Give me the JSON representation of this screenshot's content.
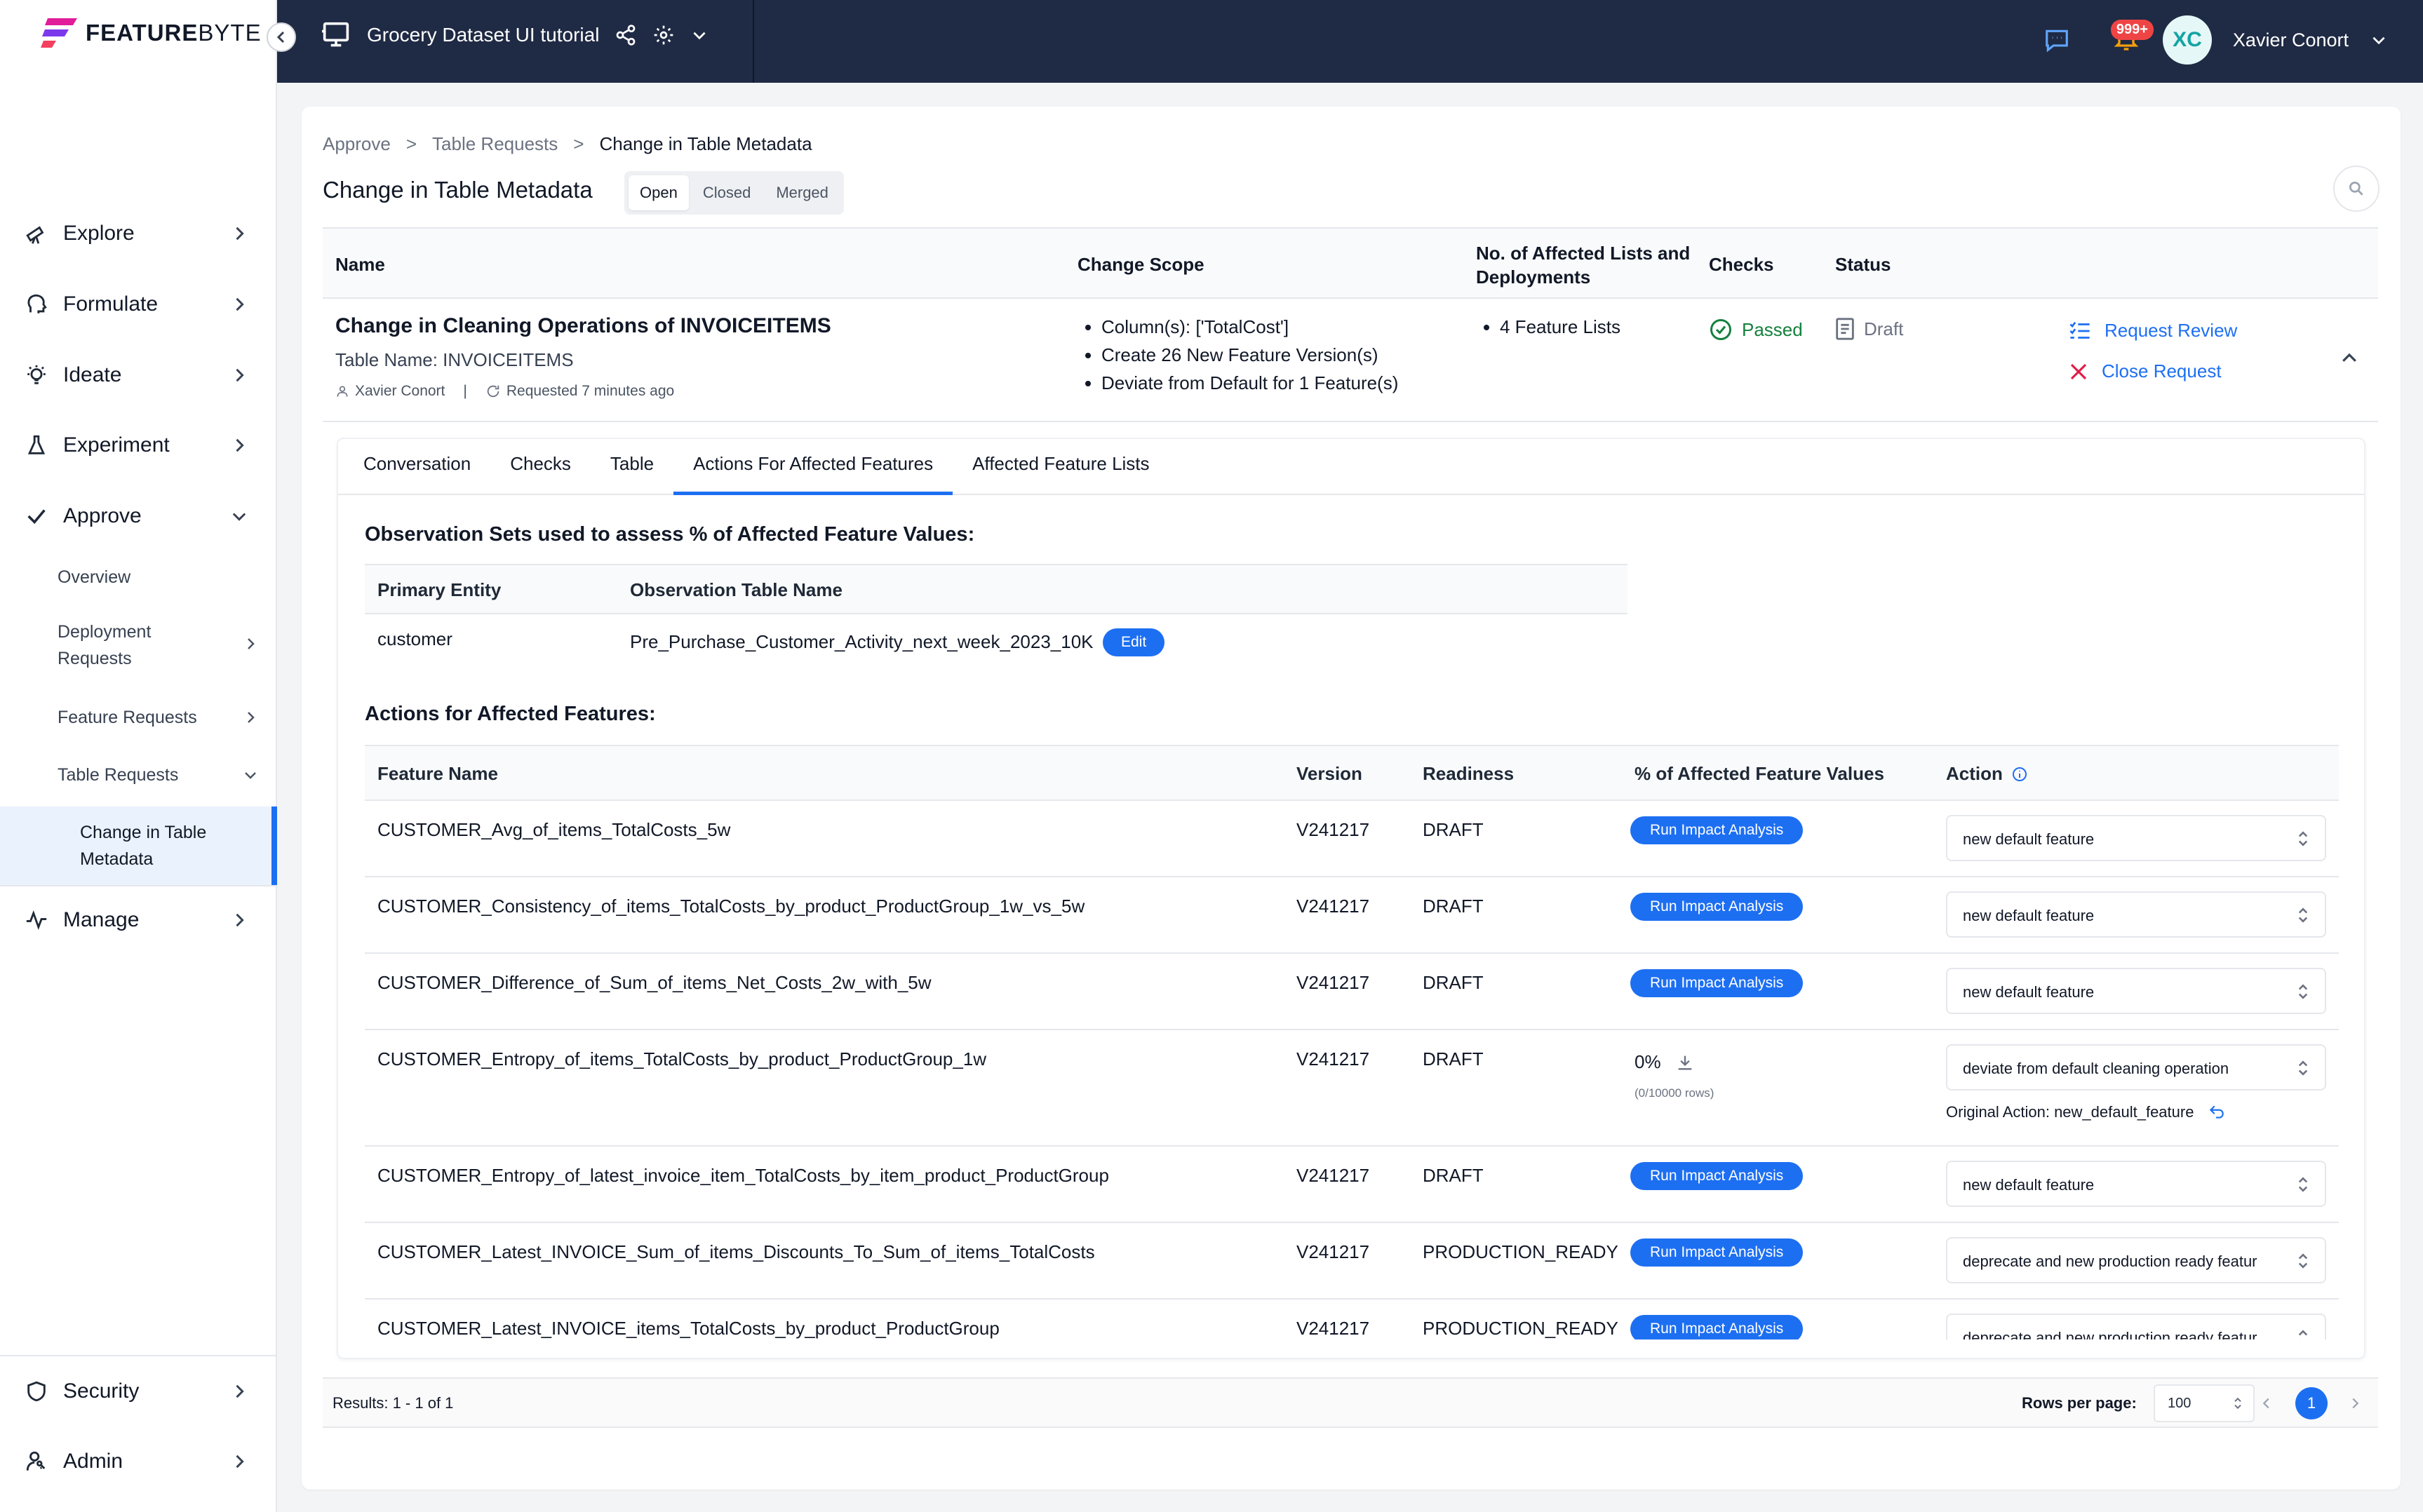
{
  "logo": {
    "text_bold": "FEATURE",
    "text_light": "BYTE"
  },
  "sidebar": {
    "nav": [
      {
        "label": "Explore",
        "icon": "telescope-icon"
      },
      {
        "label": "Formulate",
        "icon": "head-icon"
      },
      {
        "label": "Ideate",
        "icon": "lightbulb-icon"
      },
      {
        "label": "Experiment",
        "icon": "flask-icon"
      },
      {
        "label": "Approve",
        "icon": "check-icon"
      }
    ],
    "approve_sub": {
      "overview": "Overview",
      "deployment_requests_1": "Deployment",
      "deployment_requests_2": "Requests",
      "feature_requests": "Feature Requests",
      "table_requests": "Table Requests",
      "active_1": "Change in Table",
      "active_2": "Metadata"
    },
    "manage": "Manage",
    "security": "Security",
    "admin": "Admin"
  },
  "topbar": {
    "project_title": "Grocery Dataset UI tutorial",
    "notification_count": "999+",
    "user_initials": "XC",
    "user_name": "Xavier Conort"
  },
  "breadcrumb": [
    "Approve",
    ">",
    "Table Requests",
    ">",
    "Change in Table Metadata"
  ],
  "page_title": "Change in Table Metadata",
  "status_tabs": [
    "Open",
    "Closed",
    "Merged"
  ],
  "request_table": {
    "headers": {
      "name": "Name",
      "scope": "Change Scope",
      "affected_1": "No. of Affected Lists and",
      "affected_2": "Deployments",
      "checks": "Checks",
      "status": "Status"
    },
    "row": {
      "name": "Change in Cleaning Operations of INVOICEITEMS",
      "table_name": "Table Name: INVOICEITEMS",
      "author": "Xavier Conort",
      "separator": "|",
      "requested": "Requested 7 minutes ago",
      "scope": [
        "Column(s): ['TotalCost']",
        "Create 26 New Feature Version(s)",
        "Deviate from Default for 1 Feature(s)"
      ],
      "affected": [
        "4 Feature Lists"
      ],
      "checks": "Passed",
      "status": "Draft",
      "request_review": "Request Review",
      "close_request": "Close Request"
    }
  },
  "detail_tabs": [
    "Conversation",
    "Checks",
    "Table",
    "Actions For Affected Features",
    "Affected Feature Lists"
  ],
  "observation": {
    "title": "Observation Sets used to assess % of Affected Feature Values:",
    "headers": {
      "entity": "Primary Entity",
      "table": "Observation Table Name"
    },
    "row": {
      "entity": "customer",
      "table": "Pre_Purchase_Customer_Activity_next_week_2023_10K",
      "edit": "Edit"
    }
  },
  "actions": {
    "title": "Actions for Affected Features:",
    "headers": {
      "name": "Feature Name",
      "version": "Version",
      "readiness": "Readiness",
      "pct": "% of Affected Feature Values",
      "action": "Action"
    },
    "run_label": "Run Impact Analysis",
    "rows": [
      {
        "name": "CUSTOMER_Avg_of_items_TotalCosts_5w",
        "version": "V241217",
        "readiness": "DRAFT",
        "action": "new default feature"
      },
      {
        "name": "CUSTOMER_Consistency_of_items_TotalCosts_by_product_ProductGroup_1w_vs_5w",
        "version": "V241217",
        "readiness": "DRAFT",
        "action": "new default feature"
      },
      {
        "name": "CUSTOMER_Difference_of_Sum_of_items_Net_Costs_2w_with_5w",
        "version": "V241217",
        "readiness": "DRAFT",
        "action": "new default feature"
      },
      {
        "name": "CUSTOMER_Entropy_of_items_TotalCosts_by_product_ProductGroup_1w",
        "version": "V241217",
        "readiness": "DRAFT",
        "pct": "0%",
        "pct_rows": "(0/10000 rows)",
        "action": "deviate from default cleaning operation",
        "original": "Original Action: new_default_feature"
      },
      {
        "name": "CUSTOMER_Entropy_of_latest_invoice_item_TotalCosts_by_item_product_ProductGroup",
        "version": "V241217",
        "readiness": "DRAFT",
        "action": "new default feature"
      },
      {
        "name": "CUSTOMER_Latest_INVOICE_Sum_of_items_Discounts_To_Sum_of_items_TotalCosts",
        "version": "V241217",
        "readiness": "PRODUCTION_READY",
        "action": "deprecate and new production ready featur"
      },
      {
        "name": "CUSTOMER_Latest_INVOICE_items_TotalCosts_by_product_ProductGroup",
        "version": "V241217",
        "readiness": "PRODUCTION_READY",
        "action": "deprecate and new production ready featur"
      }
    ]
  },
  "pager": {
    "results": "Results: 1 - 1 of 1",
    "rows_per_page_label": "Rows per page:",
    "rows_per_page": "100",
    "page": "1"
  },
  "colors": {
    "accent": "#1d6ff2",
    "topbar": "#1f2a44",
    "passed": "#15803d",
    "close": "#e11d48"
  }
}
